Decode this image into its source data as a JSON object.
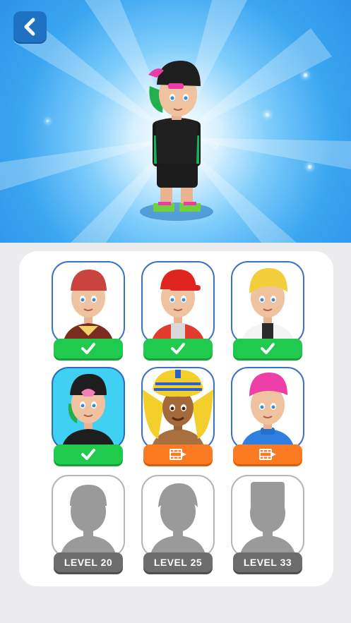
{
  "header": {
    "back_icon": "chevron-left-icon",
    "hero_character": "selected-character-preview"
  },
  "colors": {
    "green_badge": "#1fca4d",
    "orange_badge": "#fb7a22",
    "locked_badge": "#6d6d6d",
    "frame_border": "#3a72c8",
    "selected_frame": "#3fd0f4",
    "back_button": "#1f71c4"
  },
  "characters": [
    {
      "id": "red-cap-vest",
      "status": "owned",
      "icon": "checkmark-icon"
    },
    {
      "id": "red-cap-jacket",
      "status": "owned",
      "icon": "checkmark-icon"
    },
    {
      "id": "blonde-white-coat",
      "status": "owned",
      "icon": "checkmark-icon"
    },
    {
      "id": "black-cap-green-hair",
      "status": "selected",
      "icon": "checkmark-icon"
    },
    {
      "id": "pharaoh",
      "status": "watch-video",
      "icon": "video-icon"
    },
    {
      "id": "pink-hair",
      "status": "watch-video",
      "icon": "video-icon"
    },
    {
      "id": "locked-1",
      "status": "locked",
      "label": "LEVEL 20"
    },
    {
      "id": "locked-2",
      "status": "locked",
      "label": "LEVEL 25"
    },
    {
      "id": "locked-3",
      "status": "locked",
      "label": "LEVEL 33"
    }
  ]
}
